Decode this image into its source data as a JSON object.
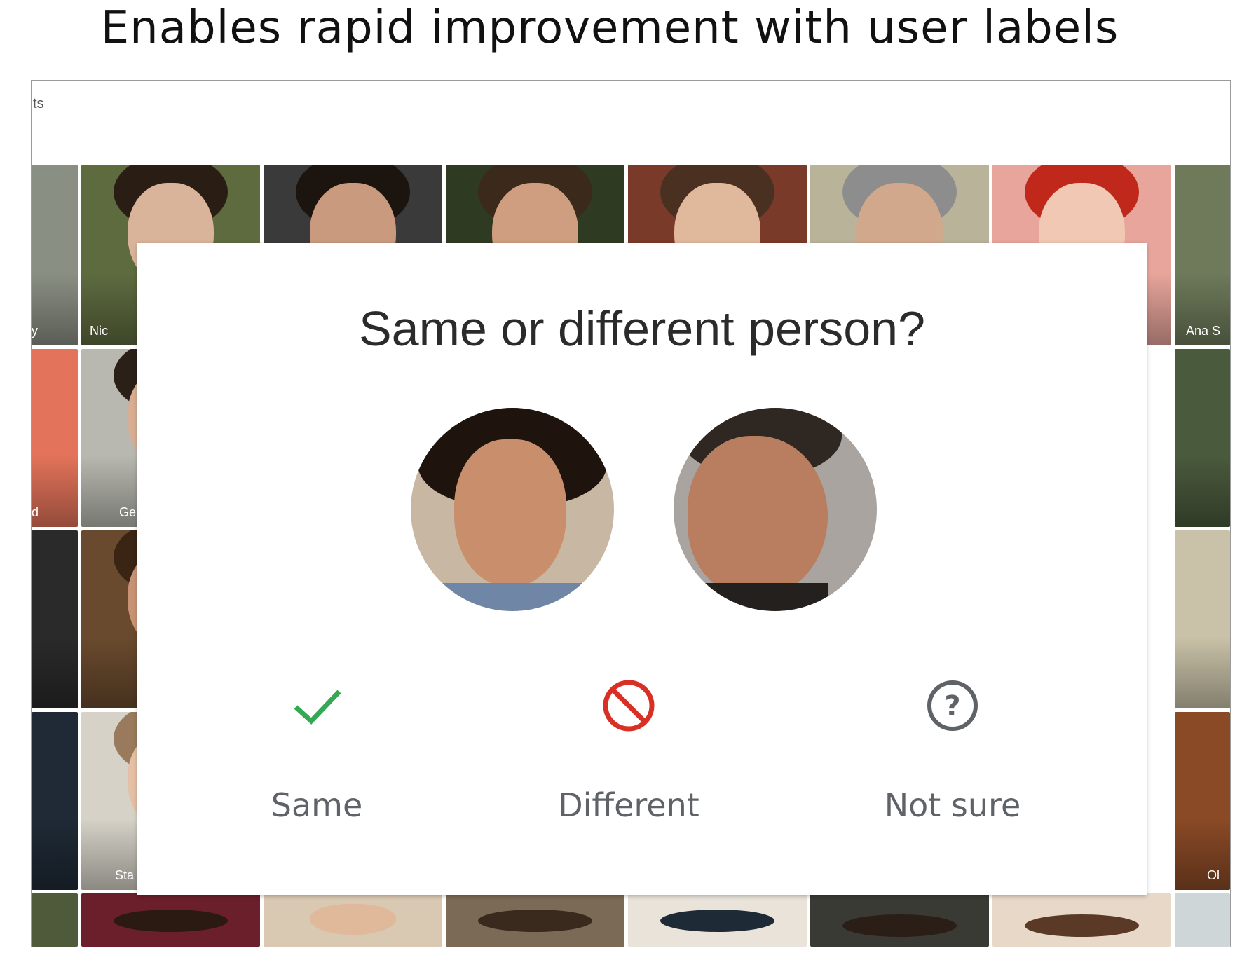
{
  "slide": {
    "title": "Enables rapid improvement with user labels"
  },
  "frame": {
    "partial_label": "ts"
  },
  "tile_names": {
    "t1": "Nic",
    "t2": "Ana S",
    "t3": "d",
    "t4": "Ge",
    "t5": "Sta",
    "t6": "Ol",
    "t7": "y"
  },
  "dialog": {
    "title": "Same or different person?",
    "options": [
      {
        "label": "Same",
        "icon": "checkmark-icon",
        "color": "#34a853"
      },
      {
        "label": "Different",
        "icon": "prohibited-icon",
        "color": "#d93025"
      },
      {
        "label": "Not sure",
        "icon": "question-circle-icon",
        "color": "#5f6368"
      }
    ]
  }
}
